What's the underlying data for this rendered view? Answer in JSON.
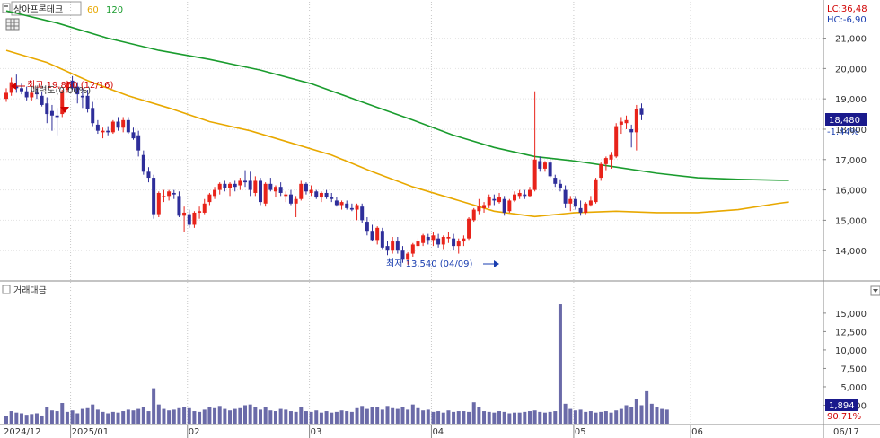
{
  "header": {
    "stock_name": "상아프론테크",
    "ma_labels": [
      {
        "label": "60",
        "color": "#e8a800"
      },
      {
        "label": "120",
        "color": "#1a9c2e"
      }
    ]
  },
  "right_info": {
    "lc": "LC:36,48",
    "hc": "HC:-6,90"
  },
  "volume_pane": {
    "title": "거래대금"
  },
  "annotations": {
    "high": "최고 19,850 (12/16)",
    "high_overlay": "매력도(0.00%)",
    "low": "최저 13,540 (04/09)"
  },
  "current": {
    "price": "18,480",
    "change": "-1.44%",
    "volume": "1,894",
    "volume_pct": "90.71%"
  },
  "chart_data": [
    {
      "type": "candlestick",
      "ylim": [
        13000,
        22200
      ],
      "y_ticks": [
        "14,000",
        "15,000",
        "16,000",
        "17,000",
        "18,000",
        "19,000",
        "20,000",
        "21,000"
      ],
      "y_tick_values": [
        14000,
        15000,
        16000,
        17000,
        18000,
        19000,
        20000,
        21000
      ],
      "x_labels": [
        "2024/12",
        "2025/01",
        "02",
        "03",
        "04",
        "05",
        "06",
        "06/17"
      ],
      "x_label_index": [
        0,
        13,
        36,
        60,
        84,
        112,
        135,
        153
      ],
      "candles": [
        [
          19000,
          19350,
          18900,
          19200
        ],
        [
          19200,
          19700,
          19100,
          19550
        ],
        [
          19400,
          19800,
          19200,
          19350
        ],
        [
          19350,
          19500,
          19150,
          19250
        ],
        [
          19250,
          19400,
          18950,
          19050
        ],
        [
          19050,
          19300,
          18950,
          19200
        ],
        [
          19200,
          19350,
          19000,
          19150
        ],
        [
          19100,
          19250,
          18750,
          18800
        ],
        [
          18850,
          19050,
          18200,
          18500
        ],
        [
          18600,
          18800,
          17950,
          18450
        ],
        [
          18450,
          18700,
          17800,
          18400
        ],
        [
          18500,
          19300,
          18400,
          19250
        ],
        [
          19300,
          19600,
          19200,
          19500
        ],
        [
          19600,
          19750,
          19300,
          19350
        ],
        [
          19400,
          19550,
          18850,
          19150
        ],
        [
          19100,
          19350,
          18700,
          19050
        ],
        [
          19100,
          19300,
          18550,
          18650
        ],
        [
          18700,
          18900,
          18100,
          18200
        ],
        [
          18150,
          18300,
          17850,
          17950
        ],
        [
          17900,
          18050,
          17700,
          17950
        ],
        [
          17950,
          18100,
          17800,
          17900
        ],
        [
          17900,
          18300,
          17850,
          18250
        ],
        [
          18250,
          18400,
          17950,
          18050
        ],
        [
          18050,
          18400,
          17900,
          18300
        ],
        [
          18300,
          18400,
          17850,
          17900
        ],
        [
          17900,
          18050,
          17650,
          17700
        ],
        [
          17800,
          17950,
          17100,
          17300
        ],
        [
          17150,
          17300,
          16500,
          16600
        ],
        [
          16600,
          16750,
          16250,
          16400
        ],
        [
          16400,
          16500,
          15050,
          15200
        ],
        [
          15200,
          15950,
          15100,
          15900
        ],
        [
          15800,
          16000,
          15600,
          15800
        ],
        [
          15800,
          16000,
          15650,
          15950
        ],
        [
          15900,
          16000,
          15700,
          15850
        ],
        [
          15800,
          15950,
          15100,
          15150
        ],
        [
          15150,
          15450,
          14600,
          15250
        ],
        [
          15200,
          15350,
          14750,
          14850
        ],
        [
          14850,
          15300,
          14750,
          15250
        ],
        [
          15250,
          15450,
          15050,
          15300
        ],
        [
          15250,
          15700,
          15200,
          15550
        ],
        [
          15600,
          15900,
          15500,
          15850
        ],
        [
          15800,
          16100,
          15700,
          16000
        ],
        [
          16000,
          16250,
          15850,
          16200
        ],
        [
          16200,
          16300,
          15950,
          16050
        ],
        [
          16050,
          16250,
          15800,
          16200
        ],
        [
          16200,
          16300,
          15950,
          16100
        ],
        [
          16150,
          16400,
          16000,
          16300
        ],
        [
          16300,
          16650,
          16100,
          16250
        ],
        [
          16300,
          16600,
          15800,
          16000
        ],
        [
          15900,
          16450,
          15800,
          16300
        ],
        [
          16300,
          16400,
          15500,
          15600
        ],
        [
          15550,
          16250,
          15450,
          16200
        ],
        [
          16200,
          16400,
          15950,
          16000
        ],
        [
          15950,
          16150,
          15750,
          16100
        ],
        [
          16100,
          16250,
          15800,
          15900
        ],
        [
          15800,
          15950,
          15600,
          15850
        ],
        [
          15850,
          16000,
          15500,
          15550
        ],
        [
          15550,
          15800,
          15100,
          15700
        ],
        [
          15700,
          16300,
          15650,
          16200
        ],
        [
          16200,
          16250,
          15850,
          15950
        ],
        [
          15900,
          16150,
          15800,
          16000
        ],
        [
          15950,
          16000,
          15700,
          15750
        ],
        [
          15750,
          15950,
          15600,
          15900
        ],
        [
          15900,
          16000,
          15700,
          15750
        ],
        [
          15750,
          15900,
          15600,
          15700
        ],
        [
          15650,
          15750,
          15450,
          15500
        ],
        [
          15500,
          15650,
          15350,
          15600
        ],
        [
          15550,
          15650,
          15350,
          15400
        ],
        [
          15400,
          15550,
          15300,
          15350
        ],
        [
          15350,
          15550,
          15000,
          15500
        ],
        [
          15450,
          15550,
          14900,
          15000
        ],
        [
          14950,
          15100,
          14500,
          14650
        ],
        [
          14650,
          14850,
          14300,
          14350
        ],
        [
          14350,
          14800,
          14200,
          14750
        ],
        [
          14650,
          14750,
          14050,
          14100
        ],
        [
          14150,
          14300,
          13850,
          14000
        ],
        [
          14000,
          14450,
          13900,
          14300
        ],
        [
          14300,
          14450,
          13900,
          14000
        ],
        [
          14000,
          14150,
          13600,
          13700
        ],
        [
          13700,
          13950,
          13540,
          13900
        ],
        [
          13900,
          14250,
          13800,
          14200
        ],
        [
          14150,
          14400,
          14050,
          14300
        ],
        [
          14250,
          14550,
          14150,
          14500
        ],
        [
          14450,
          14550,
          14200,
          14350
        ],
        [
          14350,
          14600,
          14150,
          14500
        ],
        [
          14400,
          14550,
          14100,
          14200
        ],
        [
          14200,
          14500,
          14050,
          14450
        ],
        [
          14400,
          14600,
          14250,
          14450
        ],
        [
          14400,
          14550,
          14000,
          14150
        ],
        [
          14150,
          14400,
          13900,
          14300
        ],
        [
          14300,
          14500,
          14150,
          14400
        ],
        [
          14400,
          15100,
          14350,
          15050
        ],
        [
          15000,
          15400,
          14950,
          15350
        ],
        [
          15300,
          15700,
          15200,
          15450
        ],
        [
          15400,
          15600,
          15250,
          15500
        ],
        [
          15500,
          15850,
          15400,
          15750
        ],
        [
          15700,
          15850,
          15500,
          15650
        ],
        [
          15600,
          15900,
          15550,
          15750
        ],
        [
          15700,
          15800,
          15150,
          15250
        ],
        [
          15300,
          15700,
          15250,
          15650
        ],
        [
          15650,
          15950,
          15600,
          15850
        ],
        [
          15800,
          16000,
          15700,
          15900
        ],
        [
          15850,
          16000,
          15700,
          15800
        ],
        [
          15800,
          16100,
          15750,
          16000
        ],
        [
          16000,
          19250,
          15950,
          17000
        ],
        [
          16950,
          17100,
          16600,
          16700
        ],
        [
          16700,
          16950,
          16600,
          16900
        ],
        [
          16900,
          17050,
          16400,
          16450
        ],
        [
          16400,
          16500,
          16100,
          16200
        ],
        [
          16200,
          16350,
          15950,
          16050
        ],
        [
          16000,
          16150,
          15400,
          15550
        ],
        [
          15550,
          15800,
          15300,
          15700
        ],
        [
          15700,
          15800,
          15350,
          15450
        ],
        [
          15400,
          15650,
          15150,
          15250
        ],
        [
          15250,
          15600,
          15200,
          15550
        ],
        [
          15500,
          15800,
          15450,
          15650
        ],
        [
          15600,
          16400,
          15550,
          16350
        ],
        [
          16400,
          16900,
          16300,
          16850
        ],
        [
          16850,
          17100,
          16650,
          17050
        ],
        [
          17000,
          17250,
          16700,
          17150
        ],
        [
          17100,
          18200,
          17050,
          18100
        ],
        [
          18150,
          18400,
          17850,
          18250
        ],
        [
          18200,
          18450,
          18000,
          18300
        ],
        [
          18000,
          18150,
          17400,
          17900
        ],
        [
          17900,
          18800,
          17300,
          18650
        ],
        [
          18700,
          18850,
          18300,
          18480
        ]
      ],
      "ma60": [
        [
          0,
          20600
        ],
        [
          8,
          20200
        ],
        [
          16,
          19600
        ],
        [
          24,
          19100
        ],
        [
          32,
          18700
        ],
        [
          40,
          18250
        ],
        [
          48,
          17950
        ],
        [
          56,
          17550
        ],
        [
          64,
          17150
        ],
        [
          72,
          16600
        ],
        [
          80,
          16100
        ],
        [
          88,
          15700
        ],
        [
          96,
          15300
        ],
        [
          104,
          15120
        ],
        [
          112,
          15250
        ],
        [
          120,
          15300
        ],
        [
          128,
          15250
        ],
        [
          136,
          15250
        ],
        [
          144,
          15350
        ],
        [
          152,
          15560
        ],
        [
          154,
          15600
        ]
      ],
      "ma120": [
        [
          0,
          21900
        ],
        [
          10,
          21500
        ],
        [
          20,
          21000
        ],
        [
          30,
          20600
        ],
        [
          40,
          20300
        ],
        [
          50,
          19950
        ],
        [
          60,
          19500
        ],
        [
          70,
          18900
        ],
        [
          80,
          18300
        ],
        [
          88,
          17800
        ],
        [
          96,
          17400
        ],
        [
          104,
          17100
        ],
        [
          112,
          16950
        ],
        [
          120,
          16750
        ],
        [
          128,
          16550
        ],
        [
          136,
          16400
        ],
        [
          144,
          16350
        ],
        [
          152,
          16320
        ],
        [
          154,
          16320
        ]
      ]
    },
    {
      "type": "bar",
      "title": "거래대금",
      "ylim": [
        0,
        17300
      ],
      "y_ticks": [
        "2,500",
        "5,000",
        "7,500",
        "10,000",
        "12,500",
        "15,000"
      ],
      "y_tick_values": [
        2500,
        5000,
        7500,
        10000,
        12500,
        15000
      ],
      "values": [
        1000,
        1700,
        1500,
        1400,
        1200,
        1300,
        1400,
        1100,
        2200,
        1800,
        1700,
        2800,
        1600,
        1800,
        1400,
        2000,
        2100,
        2600,
        1900,
        1600,
        1400,
        1600,
        1500,
        1700,
        1900,
        1800,
        2000,
        2200,
        1700,
        4800,
        2600,
        2000,
        1800,
        1900,
        2100,
        2300,
        2100,
        1700,
        1600,
        1900,
        2200,
        2100,
        2400,
        2000,
        1800,
        2000,
        2100,
        2500,
        2600,
        2200,
        1900,
        2200,
        1800,
        1700,
        2000,
        1900,
        1700,
        1600,
        2200,
        1700,
        1600,
        1800,
        1500,
        1700,
        1500,
        1600,
        1800,
        1700,
        1600,
        2100,
        2400,
        2000,
        2300,
        2200,
        1900,
        2400,
        2100,
        2000,
        2300,
        1900,
        2600,
        2100,
        1800,
        1900,
        1600,
        1700,
        1500,
        1800,
        1600,
        1700,
        1700,
        1600,
        2900,
        2200,
        1700,
        1600,
        1500,
        1700,
        1600,
        1400,
        1500,
        1500,
        1600,
        1700,
        1800,
        1600,
        1500,
        1600,
        1700,
        16200,
        2700,
        2000,
        1800,
        1900,
        1600,
        1700,
        1500,
        1600,
        1700,
        1500,
        1800,
        2000,
        2500,
        2200,
        3400,
        2500,
        4400,
        2700,
        2300,
        2000,
        1900
      ]
    }
  ]
}
